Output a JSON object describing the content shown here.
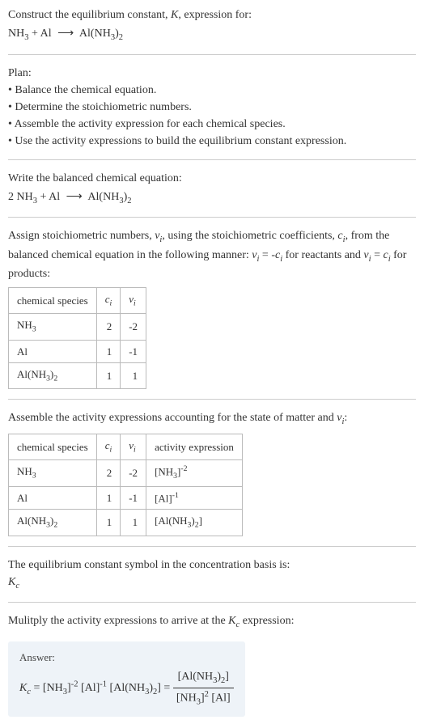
{
  "intro": {
    "line1": "Construct the equilibrium constant, K, expression for:",
    "equation": "NH₃ + Al ⟶ Al(NH₃)₂"
  },
  "plan": {
    "heading": "Plan:",
    "items": [
      "Balance the chemical equation.",
      "Determine the stoichiometric numbers.",
      "Assemble the activity expression for each chemical species.",
      "Use the activity expressions to build the equilibrium constant expression."
    ]
  },
  "balanced": {
    "heading": "Write the balanced chemical equation:",
    "equation": "2 NH₃ + Al ⟶ Al(NH₃)₂"
  },
  "stoich": {
    "text": "Assign stoichiometric numbers, νᵢ, using the stoichiometric coefficients, cᵢ, from the balanced chemical equation in the following manner: νᵢ = -cᵢ for reactants and νᵢ = cᵢ for products:",
    "table": {
      "headers": [
        "chemical species",
        "cᵢ",
        "νᵢ"
      ],
      "rows": [
        [
          "NH₃",
          "2",
          "-2"
        ],
        [
          "Al",
          "1",
          "-1"
        ],
        [
          "Al(NH₃)₂",
          "1",
          "1"
        ]
      ]
    }
  },
  "activity": {
    "heading": "Assemble the activity expressions accounting for the state of matter and νᵢ:",
    "table": {
      "headers": [
        "chemical species",
        "cᵢ",
        "νᵢ",
        "activity expression"
      ],
      "rows": [
        [
          "NH₃",
          "2",
          "-2",
          "[NH₃]⁻²"
        ],
        [
          "Al",
          "1",
          "-1",
          "[Al]⁻¹"
        ],
        [
          "Al(NH₃)₂",
          "1",
          "1",
          "[Al(NH₃)₂]"
        ]
      ]
    }
  },
  "symbol": {
    "line1": "The equilibrium constant symbol in the concentration basis is:",
    "line2": "K𝒸"
  },
  "multiply": {
    "heading": "Mulitply the activity expressions to arrive at the K𝒸 expression:"
  },
  "answer": {
    "label": "Answer:",
    "lhs": "K𝒸 = [NH₃]⁻² [Al]⁻¹ [Al(NH₃)₂] =",
    "frac_num": "[Al(NH₃)₂]",
    "frac_den": "[NH₃]² [Al]"
  },
  "chart_data": {
    "type": "table",
    "title": "Stoichiometric and activity table",
    "tables": [
      {
        "columns": [
          "chemical species",
          "c_i",
          "v_i"
        ],
        "rows": [
          {
            "chemical species": "NH3",
            "c_i": 2,
            "v_i": -2
          },
          {
            "chemical species": "Al",
            "c_i": 1,
            "v_i": -1
          },
          {
            "chemical species": "Al(NH3)2",
            "c_i": 1,
            "v_i": 1
          }
        ]
      },
      {
        "columns": [
          "chemical species",
          "c_i",
          "v_i",
          "activity expression"
        ],
        "rows": [
          {
            "chemical species": "NH3",
            "c_i": 2,
            "v_i": -2,
            "activity expression": "[NH3]^-2"
          },
          {
            "chemical species": "Al",
            "c_i": 1,
            "v_i": -1,
            "activity expression": "[Al]^-1"
          },
          {
            "chemical species": "Al(NH3)2",
            "c_i": 1,
            "v_i": 1,
            "activity expression": "[Al(NH3)2]"
          }
        ]
      }
    ]
  }
}
